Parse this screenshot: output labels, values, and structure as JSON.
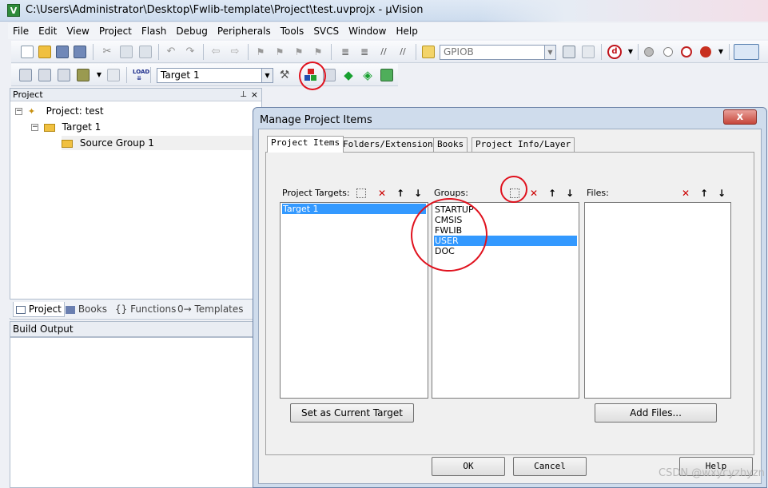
{
  "window": {
    "title": "C:\\Users\\Administrator\\Desktop\\Fwlib-template\\Project\\test.uvprojx - µVision",
    "icon_name": "uvision-app-icon"
  },
  "menu": [
    "File",
    "Edit",
    "View",
    "Project",
    "Flash",
    "Debug",
    "Peripherals",
    "Tools",
    "SVCS",
    "Window",
    "Help"
  ],
  "toolbar1": {
    "find_combo_value": "GPIOB"
  },
  "toolbar2": {
    "target_combo_value": "Target 1"
  },
  "project_panel": {
    "header": "Project",
    "pin_icon": "pin-icon",
    "tree": {
      "root": "Project: test",
      "target": "Target 1",
      "group": "Source Group 1"
    },
    "tabs": [
      "Project",
      "Books",
      "{} Functions",
      "0→ Templates"
    ]
  },
  "build_output": {
    "header": "Build Output"
  },
  "dialog": {
    "title": "Manage Project Items",
    "close_label": "x",
    "tabs": [
      "Project Items",
      "Folders/Extensions",
      "Books",
      "Project Info/Layer"
    ],
    "targets": {
      "label": "Project Targets:",
      "items": [
        "Target 1"
      ],
      "selected": "Target 1"
    },
    "groups": {
      "label": "Groups:",
      "items": [
        "STARTUP",
        "CMSIS",
        "FWLIB",
        "USER",
        "DOC"
      ],
      "selected": "USER"
    },
    "files": {
      "label": "Files:",
      "items": []
    },
    "buttons": {
      "set_current": "Set as Current Target",
      "add_files": "Add Files...",
      "ok": "OK",
      "cancel": "Cancel",
      "help": "Help"
    }
  },
  "watermark": "CSDN @wxycyzhyzn",
  "colors": {
    "selection": "#3399ff",
    "annotation": "#e0121e"
  }
}
